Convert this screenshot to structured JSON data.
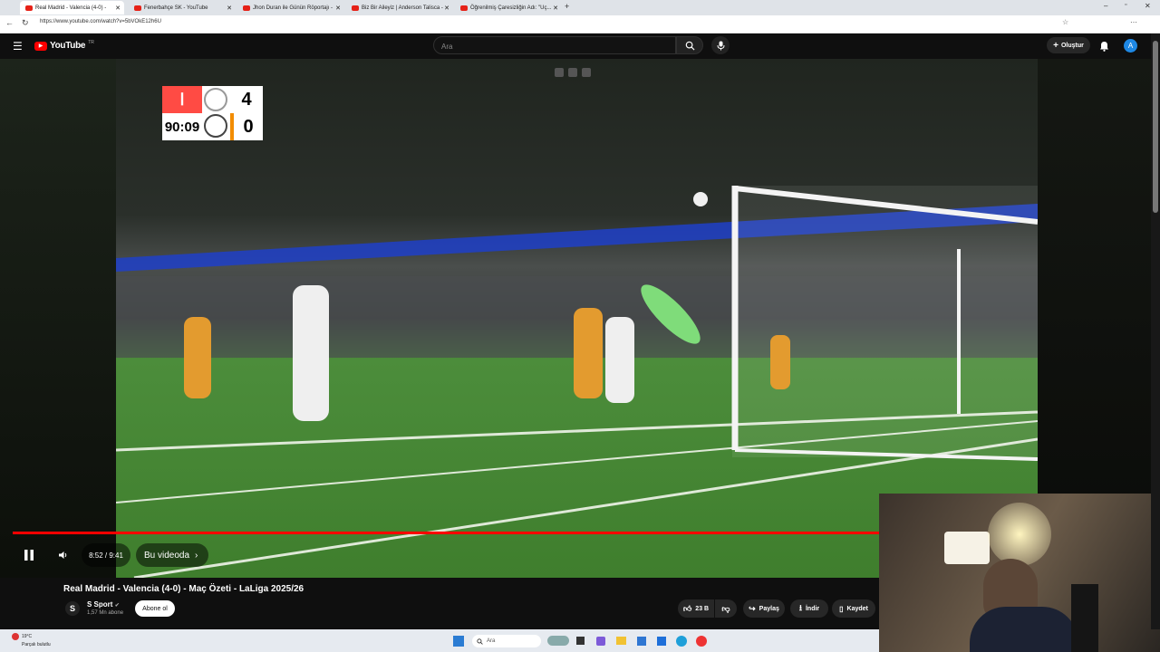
{
  "browser": {
    "tabs": [
      {
        "label": "Real Madrid - Valencia (4-0) -",
        "active": true
      },
      {
        "label": "Fenerbahçe SK - YouTube",
        "active": false
      },
      {
        "label": "Jhon Duran ile Günün Röportajı -",
        "active": false
      },
      {
        "label": "Biz Bir Aileyiz | Anderson Talisca -",
        "active": false
      },
      {
        "label": "Öğrenilmiş Çaresizliğin Adı: \"Uç...",
        "active": false
      }
    ],
    "url": "https://www.youtube.com/watch?v=5bVOkE12h6U"
  },
  "header": {
    "logo_label": "YouTube",
    "logo_region": "TR",
    "search_placeholder": "Ara",
    "create_label": "Oluştur",
    "avatar_letter": "A"
  },
  "player": {
    "scoreboard": {
      "score_home": "4",
      "score_away": "0",
      "clock": "90:09"
    },
    "time_label": "8:52 / 9:41",
    "progress_fraction": 0.9155,
    "chapter_label": "Bu videoda"
  },
  "video_info": {
    "title": "Real Madrid - Valencia (4-0) - Maç Özeti - LaLiga 2025/26",
    "channel_name": "S Sport",
    "channel_logo": "S",
    "subscribers": "1,57 Mn abone",
    "subscribe_label": "Abone ol",
    "likes": "23 B",
    "share_label": "Paylaş",
    "download_label": "İndir",
    "save_label": "Kaydet"
  },
  "taskbar": {
    "weather_temp": "19°C",
    "weather_desc": "Parçalı bulutlu",
    "search_placeholder": "Ara"
  },
  "colors": {
    "brand_red": "#ff0000",
    "background": "#0f0f0f",
    "accent_blue": "#1e88e5"
  }
}
